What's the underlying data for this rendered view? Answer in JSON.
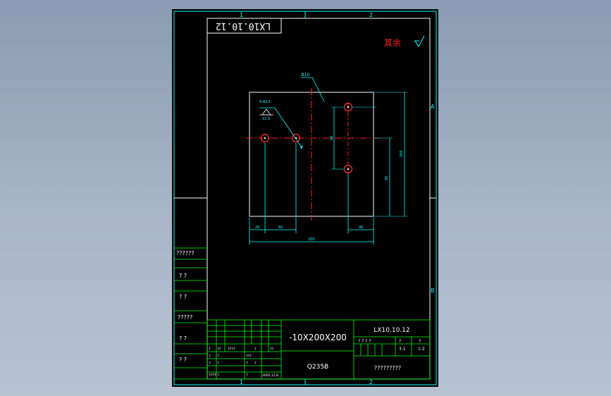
{
  "drawing_number": "LX10.10.12",
  "drawing_number_mirrored": "LX10.10.12",
  "zone_marks": {
    "col1": "1",
    "col2": "2",
    "rowA": "A",
    "rowB": "B"
  },
  "surface_note": "其余",
  "hole_callout": "Φ10",
  "hole_count_note": "4-Φ13",
  "roughness_value": "12.5",
  "dims": {
    "d25": "25",
    "d50": "50",
    "d40": "40",
    "d200": "200",
    "d_vert_small": "90",
    "d_vert_mid": "95",
    "d_vert_big": "200"
  },
  "left_panel": [
    "??????",
    "?   ?",
    "?   ?",
    "?????",
    "?   ?",
    "?   ?"
  ],
  "title_block": {
    "stock_size": "-10X200X200",
    "material": "Q235B",
    "code": "LX10.10.12",
    "row_marks": "?  ?  ?  ?",
    "scale_a": "3.1",
    "scale_b": "1:2",
    "sheet_marks_a": "?",
    "sheet_marks_b": "?",
    "company": "?????????",
    "sign_rows": [
      [
        "?",
        "??",
        "????",
        "?",
        "??"
      ],
      [
        "?",
        "?",
        "",
        "???",
        ""
      ],
      [
        "?",
        "?",
        "",
        "?",
        "?"
      ],
      [
        "????",
        "?",
        "",
        "?",
        "2005.12.8"
      ]
    ]
  },
  "colors": {
    "frame": "#00ffff",
    "titleblock": "#00ff00",
    "text": "#ffffff",
    "hole": "#ff3030",
    "center": "#ff2020",
    "accent_red": "#ff2020"
  }
}
